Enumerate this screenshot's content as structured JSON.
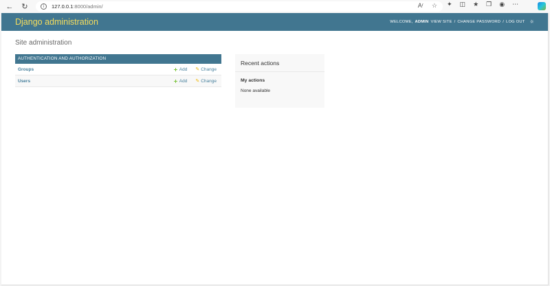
{
  "browser": {
    "url_host": "127.0.0.1",
    "url_rest": ":8000/admin/",
    "read_aloud_label": "Aʳ"
  },
  "header": {
    "branding": "Django administration",
    "welcome": "WELCOME,",
    "username": "ADMIN",
    "view_site": "VIEW SITE",
    "change_password": "CHANGE PASSWORD",
    "log_out": "LOG OUT",
    "separator": "/"
  },
  "content": {
    "title": "Site administration"
  },
  "app_module": {
    "caption": "AUTHENTICATION AND AUTHORIZATION",
    "models": [
      {
        "name": "Groups",
        "add": "Add",
        "change": "Change"
      },
      {
        "name": "Users",
        "add": "Add",
        "change": "Change"
      }
    ]
  },
  "recent": {
    "title": "Recent actions",
    "my_actions": "My actions",
    "none": "None available"
  },
  "colors": {
    "header_bg": "#417690",
    "branding": "#f5dd5d",
    "link": "#447e9b",
    "add": "#70bf2b",
    "change": "#efb80b"
  }
}
